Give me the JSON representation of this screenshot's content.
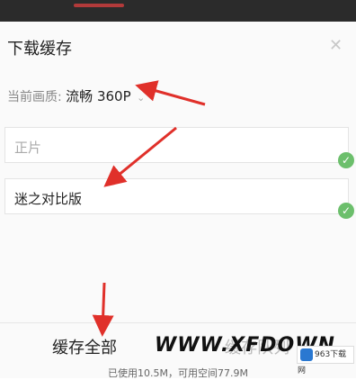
{
  "dialog": {
    "title": "下载缓存",
    "close_icon": "close-icon"
  },
  "quality": {
    "label": "当前画质:",
    "value": "流畅 360P",
    "chevron": "⌄"
  },
  "options": [
    {
      "label": "正片",
      "selected": true
    },
    {
      "label": "迷之对比版",
      "selected": true
    }
  ],
  "footer": {
    "cache_all_label": "缓存全部",
    "cache_queue_label": "缓存队列",
    "storage_text": "已使用10.5M，可用空间77.9M"
  },
  "watermark": {
    "text": "WWW.XFDOWN",
    "site_logo": "963下载网"
  },
  "colors": {
    "annotation_arrow": "#e0302a",
    "check": "#6cbf6c"
  }
}
